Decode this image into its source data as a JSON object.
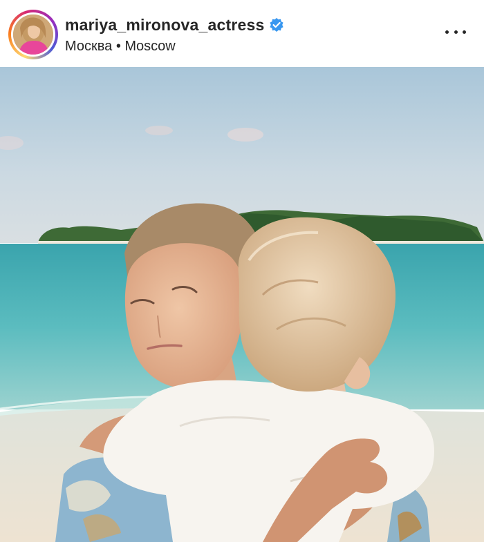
{
  "post": {
    "username": "mariya_mironova_actress",
    "verified": true,
    "location": "Москва • Moscow",
    "more_icon": "more-horizontal-icon",
    "avatar_icon": "profile-avatar",
    "photo_subject": "post-photo"
  },
  "colors": {
    "verified_blue": "#3897f0",
    "text": "#262626",
    "sea": "#4fb3b8",
    "sky": "#bcd3e3",
    "sand": "#eae1d2"
  }
}
